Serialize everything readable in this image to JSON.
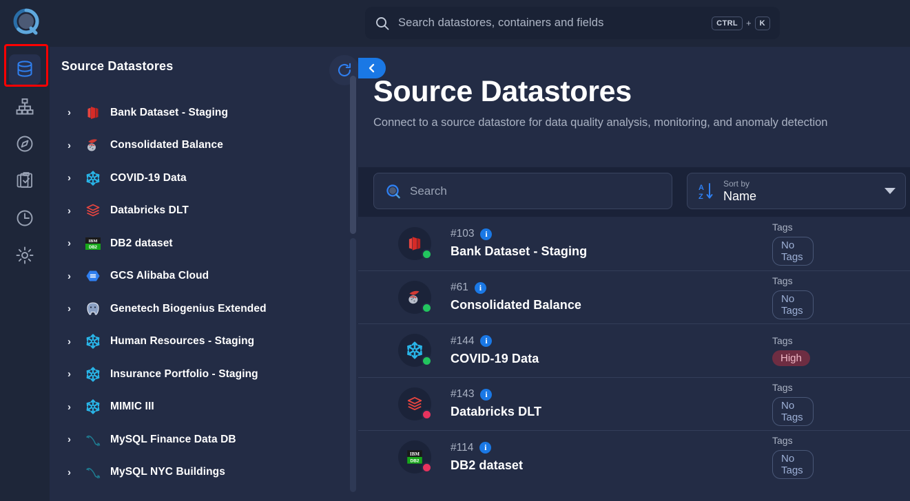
{
  "app": {
    "logo_name": "qualytics-logo",
    "accent": "#1a78e5",
    "bg_panel": "#232c45",
    "bg_dark": "#1a2238"
  },
  "topbar": {
    "search": {
      "placeholder": "Search datastores, containers and fields",
      "shortcut_key": "CTRL",
      "shortcut_plus": "+",
      "shortcut_key2": "K",
      "icon": "search-icon"
    }
  },
  "rail": {
    "items": [
      {
        "name": "datastores",
        "icon": "database-icon",
        "active": true
      },
      {
        "name": "hierarchy",
        "icon": "sitemap-icon",
        "active": false
      },
      {
        "name": "explore",
        "icon": "compass-icon",
        "active": false
      },
      {
        "name": "tasks",
        "icon": "clipboard-check-icon",
        "active": false
      },
      {
        "name": "history",
        "icon": "clock-icon",
        "active": false
      },
      {
        "name": "settings",
        "icon": "gear-icon",
        "active": false
      }
    ]
  },
  "tree": {
    "title": "Source Datastores",
    "refresh_icon": "refresh-icon",
    "caret": "›",
    "items": [
      {
        "label": "Bank Dataset - Staging",
        "icon": "redshift-icon"
      },
      {
        "label": "Consolidated Balance",
        "icon": "sqlserver-icon"
      },
      {
        "label": "COVID-19 Data",
        "icon": "snowflake-icon"
      },
      {
        "label": "Databricks DLT",
        "icon": "databricks-icon"
      },
      {
        "label": "DB2 dataset",
        "icon": "db2-icon"
      },
      {
        "label": "GCS Alibaba Cloud",
        "icon": "gcs-icon"
      },
      {
        "label": "Genetech Biogenius Extended",
        "icon": "postgres-icon"
      },
      {
        "label": "Human Resources - Staging",
        "icon": "snowflake-icon"
      },
      {
        "label": "Insurance Portfolio - Staging",
        "icon": "snowflake-icon"
      },
      {
        "label": "MIMIC III",
        "icon": "snowflake-icon"
      },
      {
        "label": "MySQL Finance Data DB",
        "icon": "mysql-icon"
      },
      {
        "label": "MySQL NYC Buildings",
        "icon": "mysql-icon"
      }
    ]
  },
  "main": {
    "collapse_icon": "chevron-left-icon",
    "title": "Source Datastores",
    "subtitle": "Connect to a source datastore for data quality analysis, monitoring, and anomaly detection",
    "search": {
      "placeholder": "Search",
      "icon": "search-icon"
    },
    "sort": {
      "icon": "sort-az-icon",
      "label": "Sort by",
      "value": "Name",
      "chevron": "chevron-down-icon"
    },
    "tags_header": "Tags",
    "rows": [
      {
        "id": "#103",
        "name": "Bank Dataset - Staging",
        "icon": "redshift-icon",
        "status": "up",
        "tags_label": "Tags",
        "tag": "No Tags",
        "tag_kind": "none"
      },
      {
        "id": "#61",
        "name": "Consolidated Balance",
        "icon": "sqlserver-icon",
        "status": "up",
        "tags_label": "Tags",
        "tag": "No Tags",
        "tag_kind": "none"
      },
      {
        "id": "#144",
        "name": "COVID-19 Data",
        "icon": "snowflake-icon",
        "status": "up",
        "tags_label": "Tags",
        "tag": "High",
        "tag_kind": "high"
      },
      {
        "id": "#143",
        "name": "Databricks DLT",
        "icon": "databricks-icon",
        "status": "down",
        "tags_label": "Tags",
        "tag": "No Tags",
        "tag_kind": "none"
      },
      {
        "id": "#114",
        "name": "DB2 dataset",
        "icon": "db2-icon",
        "status": "down",
        "tags_label": "Tags",
        "tag": "No Tags",
        "tag_kind": "none"
      }
    ]
  }
}
